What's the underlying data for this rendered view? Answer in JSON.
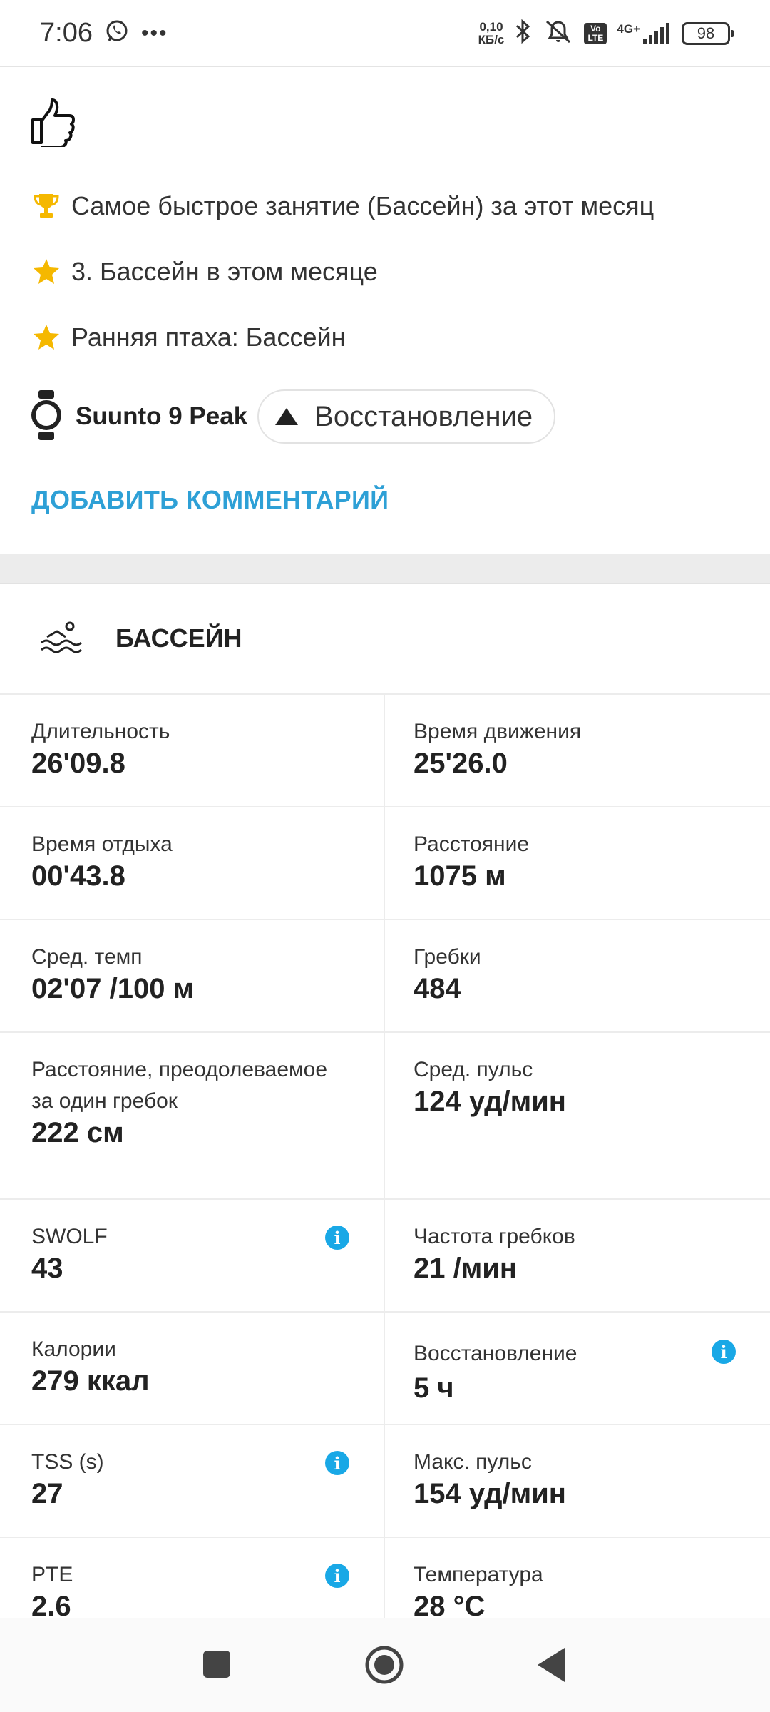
{
  "status_bar": {
    "time": "7:06",
    "speed_value": "0,10",
    "speed_unit": "КБ/с",
    "volte": "Vo LTE",
    "network": "4G+",
    "battery": "98"
  },
  "achievements": [
    {
      "icon": "trophy-icon",
      "text": "Самое быстрое занятие (Бассейн) за этот месяц"
    },
    {
      "icon": "star-icon",
      "text": "3. Бассейн в этом месяце"
    },
    {
      "icon": "star-icon",
      "text": "Ранняя птаха: Бассейн"
    }
  ],
  "device": {
    "name": "Suunto 9 Peak",
    "chip_label": "Восстановление"
  },
  "add_comment_label": "ДОБАВИТЬ КОММЕНТАРИЙ",
  "section": {
    "title": "БАССЕЙН"
  },
  "stats": [
    {
      "label": "Длительность",
      "value": "26'09.8"
    },
    {
      "label": "Время движения",
      "value": "25'26.0"
    },
    {
      "label": "Время отдыха",
      "value": "00'43.8"
    },
    {
      "label": "Расстояние",
      "value": "1075 м"
    },
    {
      "label": "Сред. темп",
      "value": "02'07 /100 м"
    },
    {
      "label": "Гребки",
      "value": "484"
    },
    {
      "label": "Расстояние, преодолеваемое за один гребок",
      "value": "222 см"
    },
    {
      "label": "Сред. пульс",
      "value": "124 уд/мин"
    },
    {
      "label": "SWOLF",
      "value": "43"
    },
    {
      "label": "Частота гребков",
      "value": "21 /мин"
    },
    {
      "label": "Калории",
      "value": "279 ккал"
    },
    {
      "label": "Восстановление",
      "value": "5 ч"
    },
    {
      "label": "TSS (s)",
      "value": "27"
    },
    {
      "label": "Макс. пульс",
      "value": "154 уд/мин"
    },
    {
      "label": "PTE",
      "value": "2.6"
    },
    {
      "label": "Температура",
      "value": "28 °C"
    }
  ],
  "colors": {
    "accent": "#2ea0d6",
    "info": "#19a8e6",
    "star": "#f5b800"
  }
}
